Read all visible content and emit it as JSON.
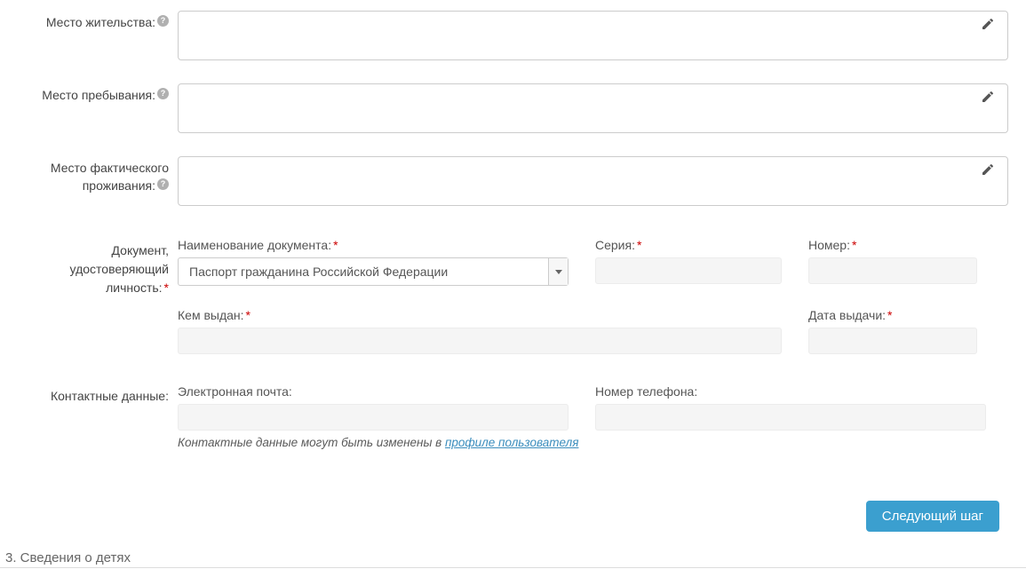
{
  "labels": {
    "residence": "Место жительства:",
    "stay": "Место пребывания:",
    "actual1": "Место фактического",
    "actual2": "проживания:",
    "document_label1": "Документ,",
    "document_label2": "удостоверяющий",
    "document_label3": "личность:",
    "contact": "Контактные данные:"
  },
  "doc": {
    "name_label": "Наименование документа:",
    "name_value": "Паспорт гражданина Российской Федерации",
    "series_label": "Серия:",
    "series_value": "",
    "number_label": "Номер:",
    "number_value": "",
    "issued_by_label": "Кем выдан:",
    "issued_by_value": "",
    "issue_date_label": "Дата выдачи:",
    "issue_date_value": ""
  },
  "contact": {
    "email_label": "Электронная почта:",
    "email_value": "",
    "phone_label": "Номер телефона:",
    "phone_value": ""
  },
  "hint": {
    "prefix": "Контактные данные могут быть изменены в ",
    "link": "профиле пользователя"
  },
  "next_button": "Следующий шаг",
  "section_footer": "3. Сведения о детях"
}
